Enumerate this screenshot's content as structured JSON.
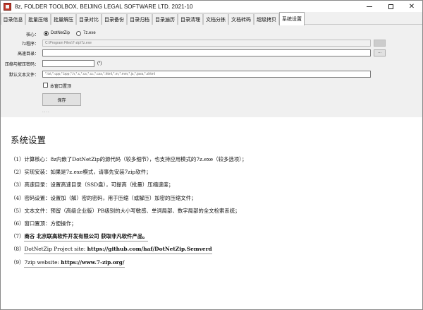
{
  "window": {
    "title": "8z, FOLDER TOOLBOX, BEIJING LEGAL SOFTWARE LTD. 2021-10",
    "minimize_glyph": "",
    "maximize_glyph": "",
    "close_glyph": "✕"
  },
  "tabs": [
    {
      "label": "目录信息",
      "active": false
    },
    {
      "label": "批量压缩",
      "active": false
    },
    {
      "label": "批量解压",
      "active": false
    },
    {
      "label": "目录对比",
      "active": false
    },
    {
      "label": "目录备份",
      "active": false
    },
    {
      "label": "目录归档",
      "active": false
    },
    {
      "label": "目录遍历",
      "active": false
    },
    {
      "label": "目录清理",
      "active": false
    },
    {
      "label": "文档分拣",
      "active": false
    },
    {
      "label": "文档转码",
      "active": false
    },
    {
      "label": "超级拷贝",
      "active": false
    },
    {
      "label": "系统设置",
      "active": true
    }
  ],
  "settings": {
    "core_label": "核心：",
    "core_options": [
      {
        "label": "DotNetZip",
        "selected": true
      },
      {
        "label": "7z.exe",
        "selected": false
      }
    ],
    "exe_label": "7z程序：",
    "exe_value": "C:\\Program Files\\7-zip\\7z.exe",
    "exe_browse": "",
    "cache_label": "高速目录：",
    "cache_value": "",
    "cache_browse": "...",
    "password_label": "压缩与解压密码：",
    "password_value": "",
    "password_hint": "(*)",
    "text_label": "默认文本文件：",
    "text_value": "*.txt,*.cpp,*.bpp,*.h,*.c,*.cs,*.cc,*.css,*.html,*.m,*.mm,*.js,*.java,*.shtml",
    "window_top_label": "本窗口置顶",
    "window_top_checked": false,
    "save_label": "保存",
    "dots": "...."
  },
  "help": {
    "heading": "系统设置",
    "items": [
      {
        "num": "（1）",
        "text": "计算核心：8z内嵌了DotNetZip的源代码（较多细节），也支持应用模式的7z.exe（较多选项）；",
        "bold": ""
      },
      {
        "num": "（2）",
        "text": "实现安装：如果是7z.exe模式，请事先安装7zip软件；",
        "bold": ""
      },
      {
        "num": "（3）",
        "text": "高速目录：设置高速目录（SSD盘），可提高（批量）压缩速度；",
        "bold": ""
      },
      {
        "num": "（4）",
        "text": "密码设置：设置加（解）密的密码，用于压缩（或解压）加密的压缩文件；",
        "bold": ""
      },
      {
        "num": "（5）",
        "text": "文本文件：预留（高级企业版）PB级别的大小写敏感、单词局部、数字局部的全文检索系统；",
        "bold": ""
      },
      {
        "num": "（6）",
        "text": "窗口置顶：方便操作；",
        "bold": ""
      },
      {
        "num": "（7）",
        "text": "",
        "bold": "商谷 北京联高软件开发有限公司 获取非凡软件产品。"
      },
      {
        "num": "（8）",
        "text": "DotNetZip Project site: ",
        "bold": "https://github.com/haf/DotNetZip.Semverd"
      },
      {
        "num": "（9）",
        "text": "7zip website: ",
        "bold": "https://www.7-zip.org/"
      }
    ]
  }
}
